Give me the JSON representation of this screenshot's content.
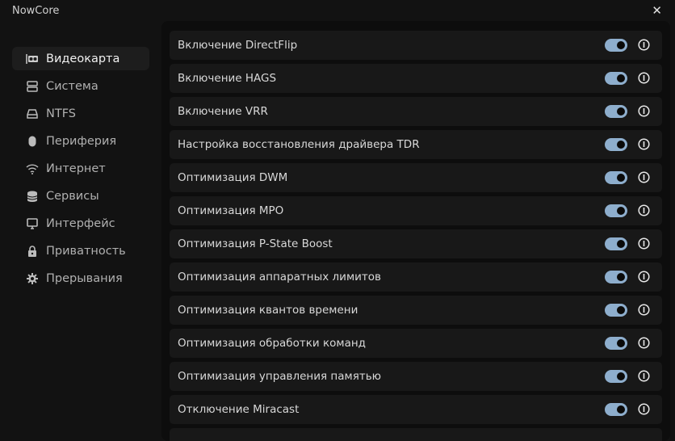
{
  "app": {
    "title": "NowCore"
  },
  "sidebar": {
    "items": [
      {
        "label": "Видеокарта",
        "icon": "gpu-icon",
        "active": true
      },
      {
        "label": "Система",
        "icon": "server-icon"
      },
      {
        "label": "NTFS",
        "icon": "hard-drive-icon"
      },
      {
        "label": "Периферия",
        "icon": "mouse-icon"
      },
      {
        "label": "Интернет",
        "icon": "wifi-icon"
      },
      {
        "label": "Сервисы",
        "icon": "database-icon"
      },
      {
        "label": "Интерфейс",
        "icon": "monitor-icon"
      },
      {
        "label": "Приватность",
        "icon": "lock-icon"
      },
      {
        "label": "Прерывания",
        "icon": "gear-icon"
      }
    ]
  },
  "settings": [
    {
      "label": "Включение DirectFlip",
      "enabled": true
    },
    {
      "label": "Включение HAGS",
      "enabled": true
    },
    {
      "label": "Включение VRR",
      "enabled": true
    },
    {
      "label": "Настройка восстановления драйвера TDR",
      "enabled": true
    },
    {
      "label": "Оптимизация DWM",
      "enabled": true
    },
    {
      "label": "Оптимизация MPO",
      "enabled": true
    },
    {
      "label": "Оптимизация P-State Boost",
      "enabled": true
    },
    {
      "label": "Оптимизация аппаратных лимитов",
      "enabled": true
    },
    {
      "label": "Оптимизация квантов времени",
      "enabled": true
    },
    {
      "label": "Оптимизация обработки команд",
      "enabled": true
    },
    {
      "label": "Оптимизация управления памятью",
      "enabled": true
    },
    {
      "label": "Отключение Miracast",
      "enabled": true
    }
  ],
  "colors": {
    "accent": "#8eaecd",
    "background": "#121212",
    "row": "#181818"
  }
}
